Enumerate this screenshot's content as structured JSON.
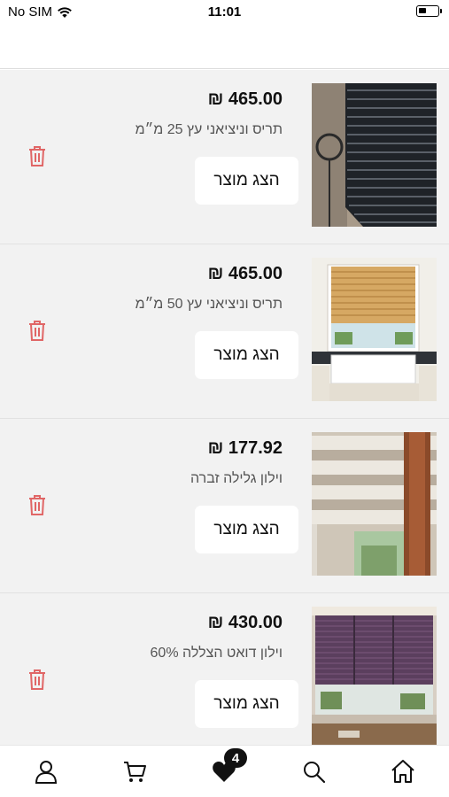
{
  "status_bar": {
    "carrier": "No SIM",
    "time": "11:01"
  },
  "colors": {
    "list_bg": "#f2f2f2",
    "trash": "#e06666",
    "badge": "#111111"
  },
  "items": [
    {
      "price": "465.00 ₪",
      "name": "תריס וניציאני עץ 25 מ״מ",
      "button": "הצג מוצר",
      "image": "dark-wood-blinds"
    },
    {
      "price": "465.00 ₪",
      "name": "תריס וניציאני עץ 50 מ״מ",
      "button": "הצג מוצר",
      "image": "natural-wood-blinds-kitchen"
    },
    {
      "price": "177.92 ₪",
      "name": "וילון גלילה זברה",
      "button": "הצג מוצר",
      "image": "zebra-roller-blind"
    },
    {
      "price": "430.00 ₪",
      "name": "וילון דואט הצללה 60%",
      "button": "הצג מוצר",
      "image": "purple-honeycomb-shades"
    }
  ],
  "tabbar": {
    "icons": [
      "user-icon",
      "cart-icon",
      "heart-icon",
      "search-icon",
      "home-icon"
    ],
    "favorites_count": "4"
  }
}
